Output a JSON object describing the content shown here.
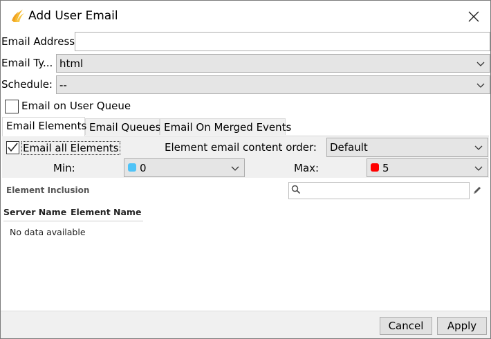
{
  "window": {
    "title": "Add User Email"
  },
  "form": {
    "email_address_label": "Email Address:",
    "email_address_value": "",
    "email_type_label": "Email Ty...",
    "email_type_value": "html",
    "schedule_label": "Schedule:",
    "schedule_value": "--",
    "queue_checkbox_label": "Email on User Queue",
    "queue_checkbox_checked": false
  },
  "tabs": [
    {
      "label": "Email Elements",
      "active": true
    },
    {
      "label": "Email Queues",
      "active": false
    },
    {
      "label": "Email On Merged Events",
      "active": false
    }
  ],
  "elements_tab": {
    "all_elements_label": "Email all Elements",
    "all_elements_checked": true,
    "order_label": "Element email content order:",
    "order_value": "Default",
    "min_label": "Min:",
    "min_value": "0",
    "min_color": "#4fc3f7",
    "max_label": "Max:",
    "max_value": "5",
    "max_color": "#ff0000",
    "inclusion_title": "Element Inclusion",
    "search_value": "",
    "columns": [
      "Server Name",
      "Element Name"
    ],
    "empty_text": "No data available"
  },
  "footer": {
    "cancel_label": "Cancel",
    "apply_label": "Apply"
  },
  "icons": {
    "app": "app-logo-icon",
    "close": "close-icon",
    "search": "search-icon",
    "edit": "pencil-icon"
  }
}
